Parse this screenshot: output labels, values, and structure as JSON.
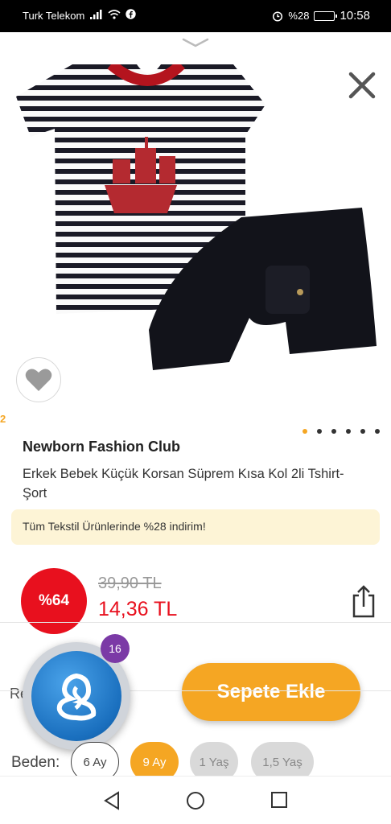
{
  "status_bar": {
    "carrier": "Turk Telekom",
    "battery": "%28",
    "time": "10:58"
  },
  "product": {
    "brand": "Newborn Fashion Club",
    "title": "Erkek Bebek Küçük Korsan Süprem Kısa Kol 2li Tshirt-Şort",
    "promo": "Tüm Tekstil Ürünlerinde %28 indirim!",
    "discount": "%64",
    "old_price": "39,90 TL",
    "new_price": "14,36 TL",
    "side_mark": "2",
    "image_count": 6,
    "active_image": 1
  },
  "actions": {
    "review_label": "Re",
    "cart_label": "Sepete Ekle",
    "assistant_badge": "16"
  },
  "sizes": {
    "label": "Beden:",
    "options": [
      {
        "label": "6 Ay",
        "state": "available"
      },
      {
        "label": "9 Ay",
        "state": "selected"
      },
      {
        "label": "1 Yaş",
        "state": "disabled"
      },
      {
        "label": "1,5 Yaş",
        "state": "disabled"
      }
    ]
  },
  "colors": {
    "accent": "#f5a623",
    "sale_red": "#e8101e",
    "badge_purple": "#7b3aa6"
  },
  "icons": [
    "wifi-icon",
    "signal-icon",
    "alarm-icon",
    "chevron-down-icon",
    "close-icon",
    "heart-icon",
    "share-icon",
    "back-icon",
    "home-icon",
    "recents-icon"
  ]
}
